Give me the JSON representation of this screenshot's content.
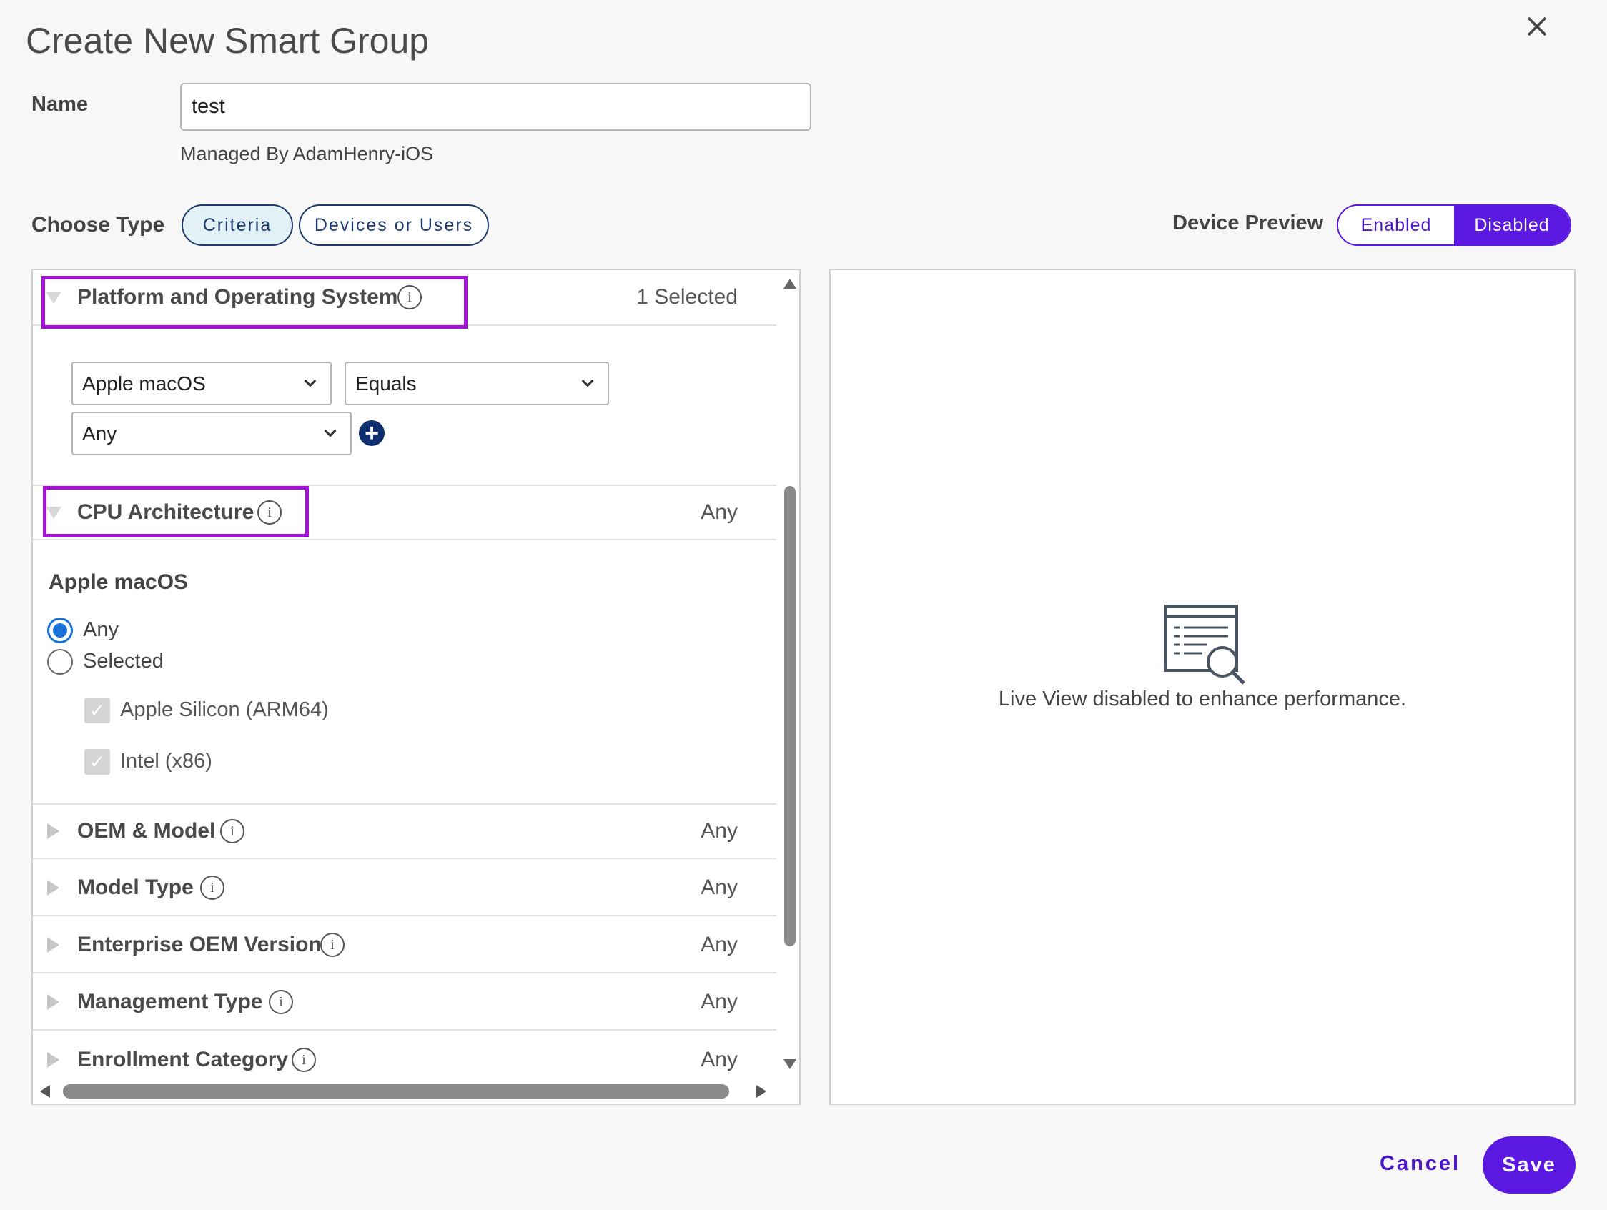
{
  "dialog": {
    "title": "Create New Smart Group"
  },
  "name_field": {
    "label": "Name",
    "value": "test",
    "managed_by": "Managed By AdamHenry-iOS"
  },
  "choose_type": {
    "label": "Choose Type",
    "options": [
      {
        "label": "Criteria",
        "selected": true
      },
      {
        "label": "Devices or Users",
        "selected": false
      }
    ]
  },
  "device_preview": {
    "label": "Device Preview",
    "enabled_label": "Enabled",
    "disabled_label": "Disabled",
    "active": "Disabled",
    "message": "Live View disabled to enhance performance."
  },
  "criteria": {
    "platform": {
      "label": "Platform and Operating System",
      "value": "1 Selected",
      "os_select": "Apple macOS",
      "operator_select": "Equals",
      "version_select": "Any"
    },
    "cpu": {
      "label": "CPU Architecture",
      "value": "Any",
      "subheading": "Apple macOS",
      "radio_any": "Any",
      "radio_selected": "Selected",
      "check_arm": "Apple Silicon (ARM64)",
      "check_intel": "Intel (x86)"
    },
    "rows": [
      {
        "label": "OEM & Model",
        "value": "Any"
      },
      {
        "label": "Model Type",
        "value": "Any"
      },
      {
        "label": "Enterprise OEM Version",
        "value": "Any"
      },
      {
        "label": "Management Type",
        "value": "Any"
      },
      {
        "label": "Enrollment Category",
        "value": "Any"
      }
    ]
  },
  "footer": {
    "cancel": "Cancel",
    "save": "Save"
  },
  "colors": {
    "accent": "#5a18e0",
    "highlight": "#a213d6",
    "navy": "#1d3b6f"
  },
  "icons": {
    "info": "i",
    "close": "close-icon",
    "add": "plus-circle-icon",
    "preview": "document-search-icon"
  }
}
